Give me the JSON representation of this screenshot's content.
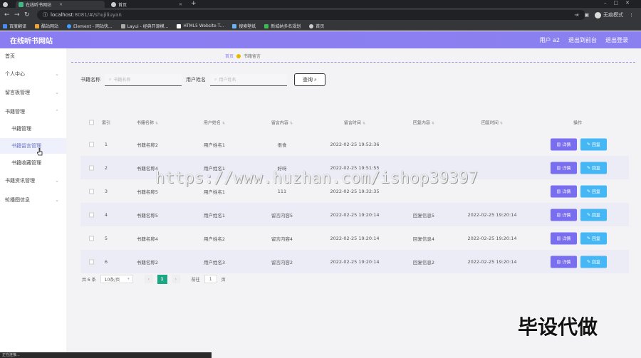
{
  "browser": {
    "tabs": [
      {
        "label": "在线听书网站",
        "active": true
      },
      {
        "label": "首页",
        "active": false
      }
    ],
    "address": {
      "host": "localhost",
      "rest": ":8081/#/shujiliuyan"
    },
    "profile_label": "无痕模式",
    "bookmarks": [
      "百度翻译",
      "酷站网站",
      "Element - 网站快...",
      "Layui - 经典开源模...",
      "HTML5 Website T...",
      "搜索壁纸",
      "新城纳多名规划",
      "首页"
    ]
  },
  "app": {
    "title": "在线听书网站",
    "user_label": "用户 a2",
    "back_label": "退出到前台",
    "logout_label": "退出登录"
  },
  "sidebar": {
    "items": [
      {
        "label": "首页",
        "expandable": false
      },
      {
        "label": "个人中心",
        "expandable": true
      },
      {
        "label": "留言板管理",
        "expandable": true
      },
      {
        "label": "书籍管理",
        "expandable": true
      },
      {
        "label": "书籍管理",
        "sub": true
      },
      {
        "label": "书籍留言管理",
        "sub": true,
        "active": true
      },
      {
        "label": "书籍收藏管理",
        "sub": true
      },
      {
        "label": "书籍资讯管理",
        "expandable": true
      },
      {
        "label": "轮播图信息",
        "expandable": true
      }
    ]
  },
  "breadcrumb": {
    "home": "首页",
    "current": "书籍留言"
  },
  "search": {
    "book_label": "书籍名称",
    "book_placeholder": "书籍名称",
    "user_label": "用户姓名",
    "user_placeholder": "用户姓名",
    "query_label": "查询"
  },
  "table": {
    "headers": {
      "index": "索引",
      "book": "书籍名称",
      "user": "用户姓名",
      "content": "留言内容",
      "time": "留言时间",
      "reply": "回复内容",
      "reply_time": "回复时间",
      "ops": "操作"
    },
    "detail_label": "详情",
    "reply_label": "回复",
    "rows": [
      {
        "index": "1",
        "book": "书籍名称2",
        "user": "用户姓名1",
        "content": "很食",
        "time": "2022-02-25 19:52:36",
        "reply": "",
        "reply_time": ""
      },
      {
        "index": "2",
        "book": "书籍名称4",
        "user": "用户姓名1",
        "content": "好呀",
        "time": "2022-02-25 19:51:55",
        "reply": "",
        "reply_time": ""
      },
      {
        "index": "3",
        "book": "书籍名称5",
        "user": "用户姓名1",
        "content": "111",
        "time": "2022-02-25 19:32:35",
        "reply": "",
        "reply_time": ""
      },
      {
        "index": "4",
        "book": "书籍名称5",
        "user": "用户姓名1",
        "content": "留言内容5",
        "time": "2022-02-25 19:20:14",
        "reply": "回复信息5",
        "reply_time": "2022-02-25 19:20:14"
      },
      {
        "index": "5",
        "book": "书籍名称4",
        "user": "用户姓名2",
        "content": "留言内容4",
        "time": "2022-02-25 19:20:14",
        "reply": "回复信息4",
        "reply_time": "2022-02-25 19:20:14"
      },
      {
        "index": "6",
        "book": "书籍名称2",
        "user": "用户姓名3",
        "content": "留言内容2",
        "time": "2022-02-25 19:20:14",
        "reply": "回复信息2",
        "reply_time": "2022-02-25 19:20:14"
      }
    ]
  },
  "pager": {
    "total": "共 6 条",
    "page_size": "10条/页",
    "current_page": "1",
    "goto_label": "前往",
    "goto_value": "1",
    "page_unit": "页"
  },
  "overlay": {
    "watermark": "https://www.huzhan.com/ishop39397",
    "stamp": "毕设代做"
  },
  "statusbar": "正在连接...",
  "colors": {
    "accent": "#8a7df2",
    "detail": "#7a6ef0",
    "reply": "#46b7f5",
    "page_active": "#1ba784"
  }
}
